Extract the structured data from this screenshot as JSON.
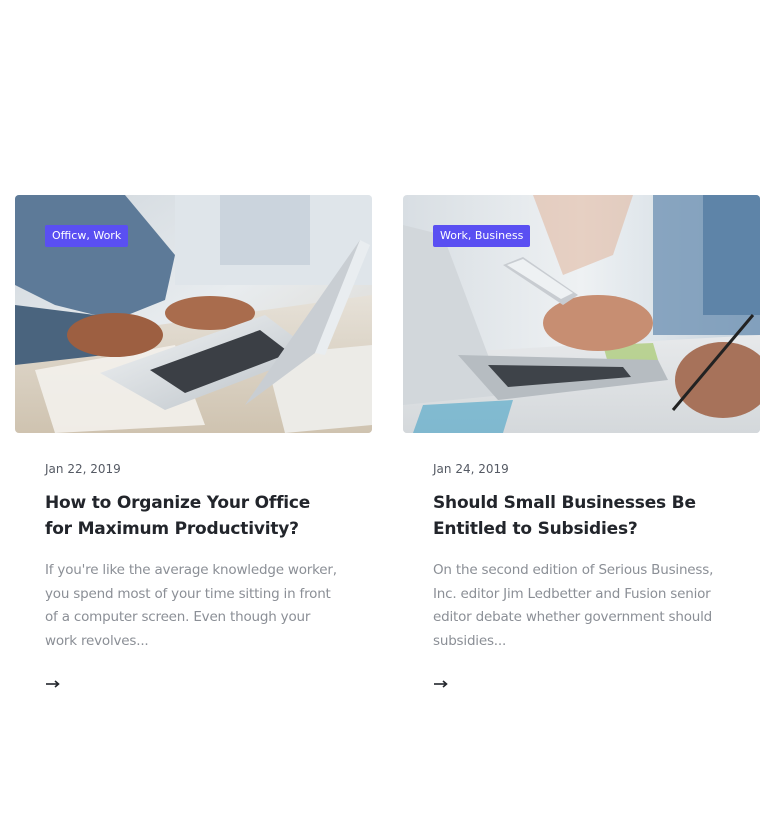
{
  "posts": [
    {
      "tag": "Officw, Work",
      "date": "Jan 22, 2019",
      "title": "How to Organize Your Office for Maximum Productivity?",
      "excerpt": "If you're like the average knowledge worker, you spend most of your time sitting in front of a computer screen. Even though your work revolves...",
      "read_more_icon": "arrow-right-icon",
      "image": "photo of hands typing on a laptop"
    },
    {
      "tag": "Work, Business",
      "date": "Jan 24, 2019",
      "title": "Should Small Businesses Be Entitled to Subsidies?",
      "excerpt": "On the second edition of Serious Business, Inc. editor Jim Ledbetter and Fusion senior editor debate whether government should subsidies...",
      "read_more_icon": "arrow-right-icon",
      "image": "photo of hands holding a phone and writing"
    }
  ],
  "colors": {
    "tag_background": "#5a4ff2",
    "title": "#22252b",
    "excerpt": "#8b8f96",
    "date": "#555a64"
  }
}
